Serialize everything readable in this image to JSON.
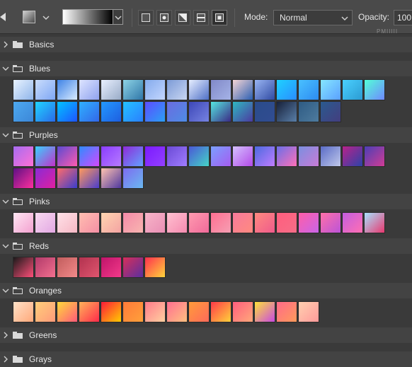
{
  "toolbar": {
    "mode_label": "Mode:",
    "mode_value": "Normal",
    "opacity_label": "Opacity:",
    "opacity_value": "100"
  },
  "icons": [
    "gradient-tool-icon",
    "swatch-preset-icon",
    "chevron-down-icon",
    "linear-gradient-icon",
    "radial-gradient-icon",
    "angle-gradient-icon",
    "reflected-gradient-icon",
    "diamond-gradient-icon",
    "folder-icon",
    "chevron-right-icon"
  ],
  "ruler_text": "PMIIIII",
  "groups": [
    {
      "name": "Basics",
      "expanded": false,
      "swatches": []
    },
    {
      "name": "Blues",
      "expanded": true,
      "swatches": [
        [
          "#e9f3ff",
          "#8fb5ea"
        ],
        [
          "#c9dcfb",
          "#7ea7f5"
        ],
        [
          "#3f83e6",
          "#d9ecff"
        ],
        [
          "#dde4ff",
          "#8fa2ef"
        ],
        [
          "#e9f0ff",
          "#98abc7"
        ],
        [
          "#8dd3e5",
          "#2f76a8"
        ],
        [
          "#85abec",
          "#c3d6ff"
        ],
        [
          "#7d9bd7",
          "#c8d6f2"
        ],
        [
          "#e6eeff",
          "#4e6fc6"
        ],
        [
          "#8189c8",
          "#a5b3e7"
        ],
        [
          "#f6d5d5",
          "#2b5fb2"
        ],
        [
          "#99b4f2",
          "#2f4aa2"
        ],
        [
          "#1ed1ff",
          "#2a8dff"
        ],
        [
          "#49c0ff",
          "#2d8bf2"
        ],
        [
          "#85e6ff",
          "#5aa0ff"
        ],
        [
          "#4ad0ff",
          "#2b9bd2"
        ],
        [
          "#53ffd7",
          "#6f89ff"
        ],
        [
          "#4da9f0",
          "#3c87d8"
        ],
        [
          "#1fd5ff",
          "#2b6ae9"
        ],
        [
          "#00c3ff",
          "#1f54ff"
        ],
        [
          "#2fb0ff",
          "#3367e8"
        ],
        [
          "#2399ff",
          "#1e5ee0"
        ],
        [
          "#24c2ff",
          "#2a7fff"
        ],
        [
          "#5d4dff",
          "#2aa0f5"
        ],
        [
          "#6a6ce0",
          "#4e8ce5"
        ],
        [
          "#3d47b8",
          "#7683e1"
        ],
        [
          "#55e6e0",
          "#3b2a85"
        ],
        [
          "#2fb8c1",
          "#4c3aa0"
        ],
        [
          "#2a4b8b",
          "#314d91"
        ],
        [
          "#17213b",
          "#5a7fa8"
        ],
        [
          "#2e5b84",
          "#4e7b9e"
        ],
        [
          "#2a5a8f",
          "#443e7f"
        ]
      ]
    },
    {
      "name": "Purples",
      "expanded": true,
      "swatches": [
        [
          "#a66cf0",
          "#ff70d6"
        ],
        [
          "#39d0ff",
          "#c231c9"
        ],
        [
          "#5a4ad1",
          "#ff5bb0"
        ],
        [
          "#2d8cff",
          "#d548ff"
        ],
        [
          "#8a3dff",
          "#b77bff"
        ],
        [
          "#8e2bd8",
          "#63a1ff"
        ],
        [
          "#7b1aff",
          "#9340ff"
        ],
        [
          "#6b4ad6",
          "#a07dff"
        ],
        [
          "#4a58d6",
          "#45d4c7"
        ],
        [
          "#7aa0ff",
          "#a55cf0"
        ],
        [
          "#d4c1ff",
          "#b34be8"
        ],
        [
          "#4c6ae0",
          "#c07dff"
        ],
        [
          "#6a6fe8",
          "#ff70b8"
        ],
        [
          "#7b8fe0",
          "#c97bd6"
        ],
        [
          "#5a6cc7",
          "#c0c8ea"
        ],
        [
          "#b8228a",
          "#2c43a8"
        ],
        [
          "#4b3fb5",
          "#d13c95"
        ],
        [
          "#5d1084",
          "#ff2f9f"
        ],
        [
          "#8a2bd6",
          "#e21f9f"
        ],
        [
          "#ff6b6b",
          "#3a3dcc"
        ],
        [
          "#ff9a5c",
          "#4a3dcc"
        ],
        [
          "#ffc3b0",
          "#4e38a0"
        ],
        [
          "#7d6cf0",
          "#6ab8f0"
        ]
      ]
    },
    {
      "name": "Pinks",
      "expanded": true,
      "swatches": [
        [
          "#ffe6f3",
          "#f3a1d0"
        ],
        [
          "#f9d9f0",
          "#e2a8e3"
        ],
        [
          "#ffe1e8",
          "#f6b8c5"
        ],
        [
          "#ffbeb0",
          "#f58fa5"
        ],
        [
          "#ffd5b0",
          "#f4a3a3"
        ],
        [
          "#f48aa8",
          "#f8b5b0"
        ],
        [
          "#f7b4c8",
          "#e98fb5"
        ],
        [
          "#ffc0d0",
          "#f58bb0"
        ],
        [
          "#ff9bb0",
          "#f06a9a"
        ],
        [
          "#ff6f91",
          "#f59fb3"
        ],
        [
          "#f77a9b",
          "#ff8a7f"
        ],
        [
          "#ff8a7f",
          "#ef5b8c"
        ],
        [
          "#ff5e7e",
          "#f66d87"
        ],
        [
          "#ff5ea8",
          "#c865e8"
        ],
        [
          "#ff70a8",
          "#bb54d8"
        ],
        [
          "#c35ee0",
          "#ff6fb2"
        ],
        [
          "#a8e3ff",
          "#e8386f"
        ]
      ]
    },
    {
      "name": "Reds",
      "expanded": true,
      "swatches": [
        [
          "#1a1a1a",
          "#ff4f7a"
        ],
        [
          "#b23a6a",
          "#f3708f"
        ],
        [
          "#c25d5d",
          "#f28a8a"
        ],
        [
          "#b2324f",
          "#e0566f"
        ],
        [
          "#c0146a",
          "#f23a8a"
        ],
        [
          "#d62f5a",
          "#5a2fa0"
        ],
        [
          "#ff2f4f",
          "#ffd43a"
        ]
      ]
    },
    {
      "name": "Oranges",
      "expanded": true,
      "swatches": [
        [
          "#ffe2c8",
          "#ffa87a"
        ],
        [
          "#ffcf7a",
          "#ff9a7a"
        ],
        [
          "#ffd93a",
          "#ff5a7a"
        ],
        [
          "#ffb25a",
          "#ff2a4a"
        ],
        [
          "#ff1a3a",
          "#ffcc00"
        ],
        [
          "#ff7a3a",
          "#ffa03a"
        ],
        [
          "#ff7a8a",
          "#ffd0a0"
        ],
        [
          "#ff6f91",
          "#ffc080"
        ],
        [
          "#ff9b3a",
          "#ff6a5a"
        ],
        [
          "#ff3a4a",
          "#ffd13a"
        ],
        [
          "#ff5e7e",
          "#ffa87a"
        ],
        [
          "#ffe13a",
          "#c84ae0"
        ],
        [
          "#ff6a8a",
          "#ff9a5a"
        ],
        [
          "#ffd0b0",
          "#ff9a9a"
        ]
      ]
    },
    {
      "name": "Greens",
      "expanded": false,
      "swatches": []
    },
    {
      "name": "Grays",
      "expanded": false,
      "swatches": []
    }
  ]
}
